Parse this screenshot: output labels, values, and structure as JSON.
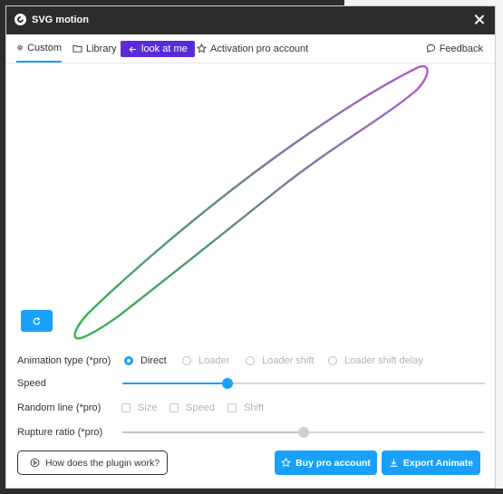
{
  "app": {
    "title": "SVG motion"
  },
  "tabs": {
    "custom": "Custom",
    "library": "Library",
    "look_at_me": "look at me",
    "activation": "Activation pro account",
    "feedback": "Feedback"
  },
  "controls": {
    "animation_type": {
      "label": "Animation type (*pro)",
      "options": [
        "Direct",
        "Loader",
        "Loader shift",
        "Loader shift delay"
      ],
      "selected": "Direct"
    },
    "speed": {
      "label": "Speed",
      "value_fraction": 0.29
    },
    "random_line": {
      "label": "Random line (*pro)",
      "options": [
        "Size",
        "Speed",
        "Shift"
      ]
    },
    "rupture_ratio": {
      "label": "Rupture ratio (*pro)",
      "value_fraction": 0.5
    }
  },
  "footer": {
    "help": "How does the plugin work?",
    "buy": "Buy pro account",
    "export": "Export Animate"
  },
  "colors": {
    "accent": "#18a0fb",
    "look_at_me_bg": "#5b2bd8",
    "titlebar": "#2c2c2c",
    "path_start": "#2db84b",
    "path_end": "#b45cd6"
  },
  "icons": {
    "tab_custom": "gear-icon",
    "tab_library": "folder-icon",
    "look_at_me": "arrow-left-icon",
    "activation": "star-icon",
    "feedback": "chat-bubble-icon",
    "refresh": "refresh-icon",
    "help": "play-circle-icon",
    "buy": "star-icon",
    "export": "download-icon"
  }
}
